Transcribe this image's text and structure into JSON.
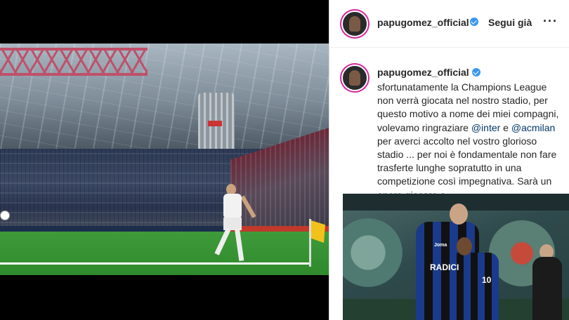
{
  "post": {
    "image_alt_role": "post photo"
  },
  "header": {
    "username": "papugomez_official",
    "separator": "•",
    "follow_label": "Segui già",
    "more_label": "···"
  },
  "comment": {
    "username": "papugomez_official",
    "text_1": " sfortunatamente la Champions League non verrà giocata nel nostro stadio, per questo motivo a nome dei miei compagni, volevamo ringraziare ",
    "mention_1": "@inter",
    "text_2": " e ",
    "mention_2": "@acmilan",
    "text_3": " per averci accolto nel vostro glorioso stadio ... per noi è fondamentale non fare trasferte lunghe sopratutto in una competizione così impegnativa. Sarà un onore giocare a"
  },
  "inset": {
    "sponsor_text": "RADICI",
    "badge_text": "Joma",
    "number_text": "10"
  },
  "colors": {
    "verified": "#3897f0",
    "mention": "#00376b",
    "avatar_ring": "#d6249f"
  },
  "icons": {
    "verified": "verified-badge-icon",
    "more": "more-options-icon"
  }
}
